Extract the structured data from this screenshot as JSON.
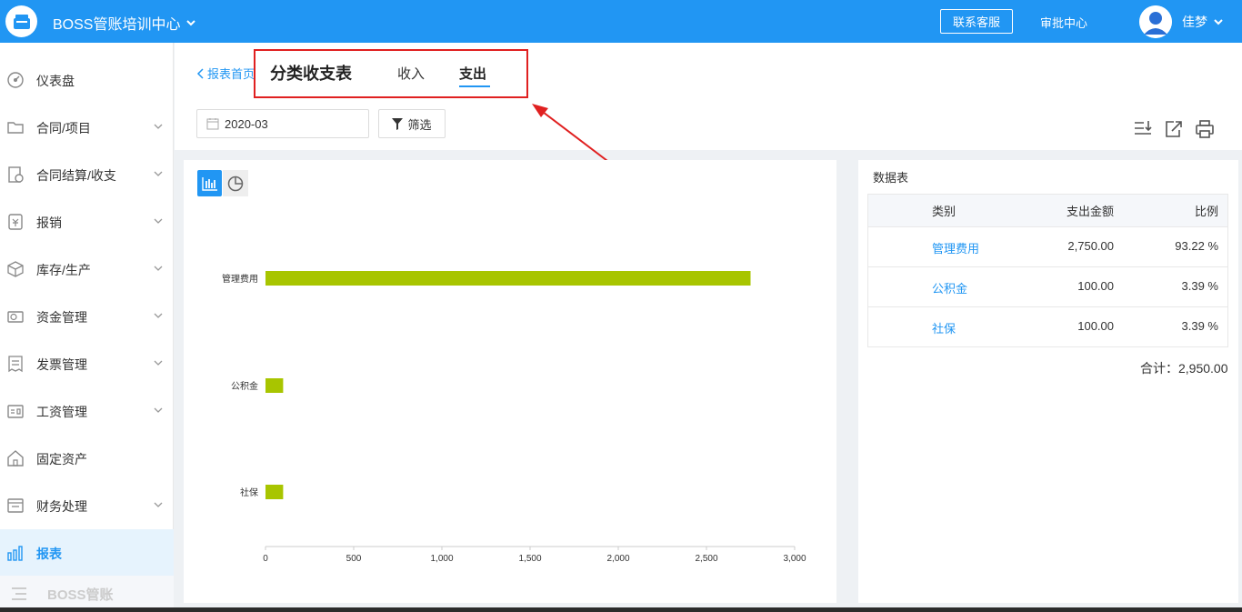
{
  "header": {
    "org_name": "BOSS管账培训中心",
    "service_button": "联系客服",
    "approval_link": "审批中心",
    "user_name": "佳梦"
  },
  "sidebar": {
    "items": [
      {
        "label": "仪表盘",
        "icon": "dashboard-icon",
        "has_chevron": false
      },
      {
        "label": "合同/项目",
        "icon": "folder-icon",
        "has_chevron": true
      },
      {
        "label": "合同结算/收支",
        "icon": "settlement-icon",
        "has_chevron": true
      },
      {
        "label": "报销",
        "icon": "reimburse-icon",
        "has_chevron": true
      },
      {
        "label": "库存/生产",
        "icon": "box-icon",
        "has_chevron": true
      },
      {
        "label": "资金管理",
        "icon": "money-icon",
        "has_chevron": true
      },
      {
        "label": "发票管理",
        "icon": "invoice-icon",
        "has_chevron": true
      },
      {
        "label": "工资管理",
        "icon": "salary-icon",
        "has_chevron": true
      },
      {
        "label": "固定资产",
        "icon": "asset-icon",
        "has_chevron": false
      },
      {
        "label": "财务处理",
        "icon": "finance-icon",
        "has_chevron": true
      },
      {
        "label": "报表",
        "icon": "report-icon",
        "has_chevron": false,
        "active": true
      }
    ],
    "footer_label": "BOSS管账"
  },
  "page": {
    "back_link": "报表首页",
    "title": "分类收支表",
    "tabs": [
      {
        "label": "收入",
        "active": false
      },
      {
        "label": "支出",
        "active": true
      }
    ],
    "date_value": "2020-03",
    "filter_label": "筛选"
  },
  "chart_data": {
    "type": "bar",
    "orientation": "horizontal",
    "categories": [
      "管理费用",
      "公积金",
      "社保"
    ],
    "values": [
      2750,
      100,
      100
    ],
    "xlim": [
      0,
      3000
    ],
    "xticks": [
      "0",
      "500",
      "1,000",
      "1,500",
      "2,000",
      "2,500",
      "3,000"
    ],
    "color": "#a8c500"
  },
  "data_table": {
    "title": "数据表",
    "columns": [
      "类别",
      "支出金额",
      "比例"
    ],
    "rows": [
      {
        "category": "管理费用",
        "amount": "2,750.00",
        "ratio": "93.22 %"
      },
      {
        "category": "公积金",
        "amount": "100.00",
        "ratio": "3.39 %"
      },
      {
        "category": "社保",
        "amount": "100.00",
        "ratio": "3.39 %"
      }
    ],
    "total": "合计：2,950.00"
  },
  "colors": {
    "brand": "#2196f3",
    "annotation": "#e02020"
  }
}
